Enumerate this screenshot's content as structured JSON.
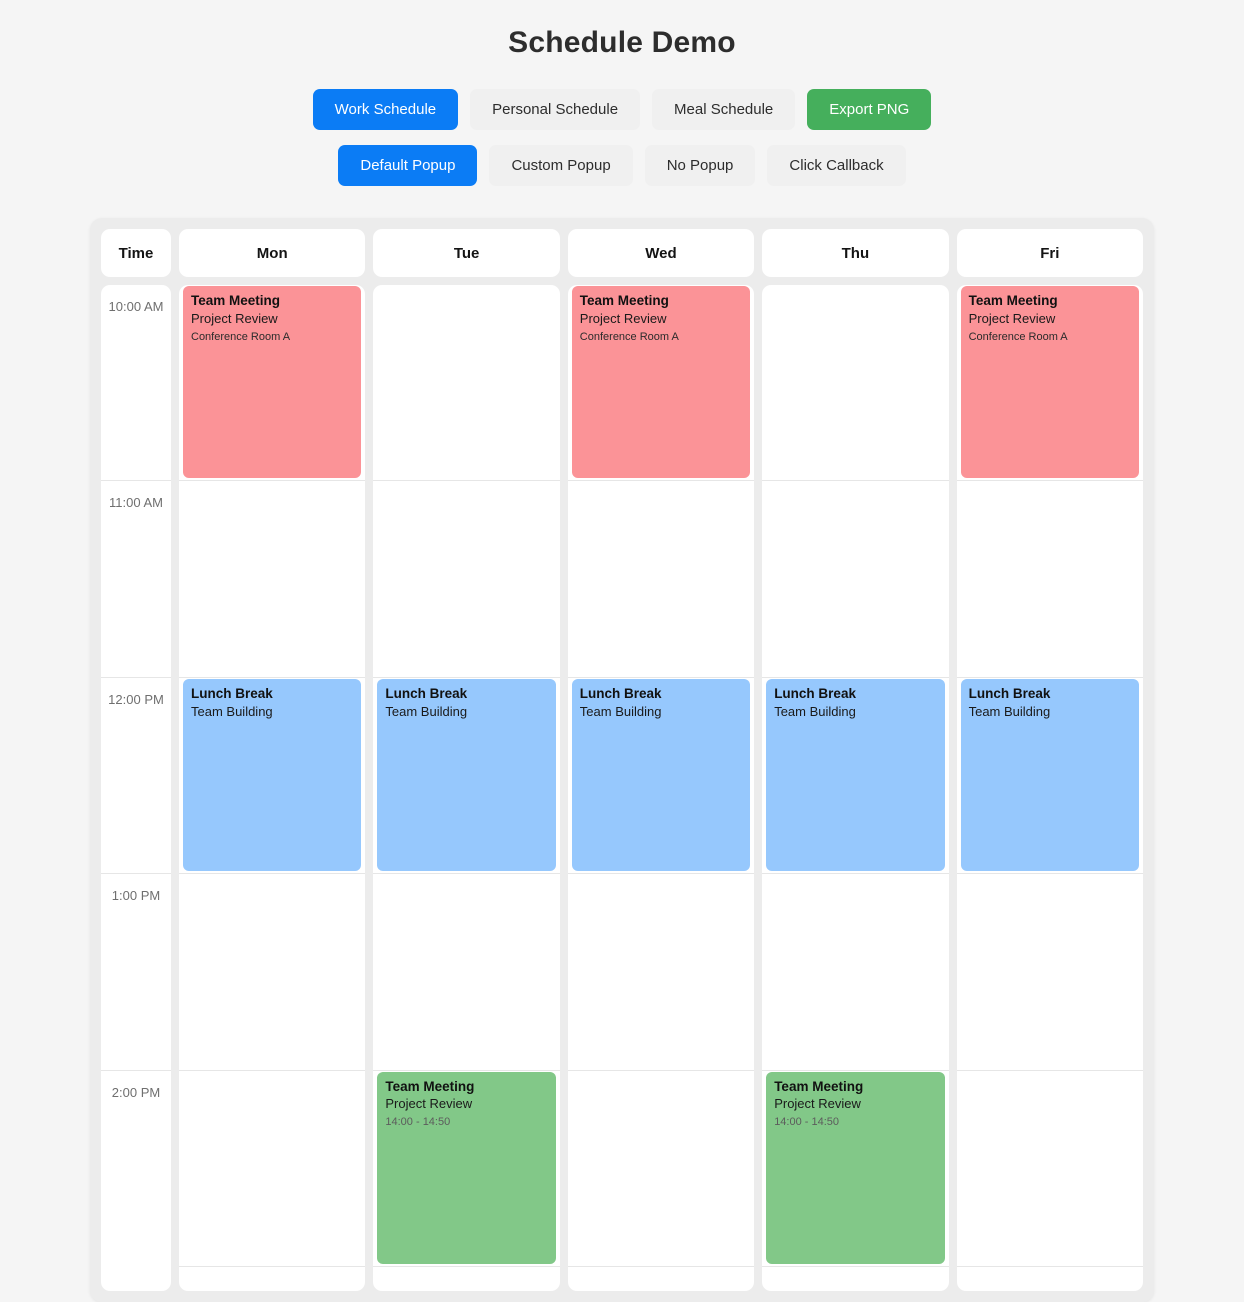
{
  "header": {
    "title": "Schedule Demo"
  },
  "toolbar": {
    "schedule_buttons": [
      {
        "label": "Work Schedule",
        "style": "primary",
        "active": true
      },
      {
        "label": "Personal Schedule",
        "style": "default",
        "active": false
      },
      {
        "label": "Meal Schedule",
        "style": "default",
        "active": false
      },
      {
        "label": "Export PNG",
        "style": "success",
        "active": false
      }
    ],
    "popup_buttons": [
      {
        "label": "Default Popup",
        "style": "primary",
        "active": true
      },
      {
        "label": "Custom Popup",
        "style": "default",
        "active": false
      },
      {
        "label": "No Popup",
        "style": "default",
        "active": false
      },
      {
        "label": "Click Callback",
        "style": "default",
        "active": false
      }
    ]
  },
  "calendar": {
    "columns": [
      "Time",
      "Mon",
      "Tue",
      "Wed",
      "Thu",
      "Fri"
    ],
    "time_slots": [
      "10:00 AM",
      "11:00 AM",
      "12:00 PM",
      "1:00 PM",
      "2:00 PM"
    ],
    "colors": {
      "meeting_red": "#fb9397",
      "lunch_blue": "#96c8fd",
      "meeting_green": "#82c888",
      "accent_blue": "#0b7cf5",
      "accent_green": "#45af5c",
      "panel_bg": "#ececec",
      "cell_bg": "#ffffff"
    },
    "events": [
      {
        "day": "Mon",
        "slot_index": 0,
        "span": 1,
        "title": "Team Meeting",
        "subtitle": "Project Review",
        "meta": "Conference Room A",
        "meta_muted": false,
        "color": "#fb9397"
      },
      {
        "day": "Wed",
        "slot_index": 0,
        "span": 1,
        "title": "Team Meeting",
        "subtitle": "Project Review",
        "meta": "Conference Room A",
        "meta_muted": false,
        "color": "#fb9397"
      },
      {
        "day": "Fri",
        "slot_index": 0,
        "span": 1,
        "title": "Team Meeting",
        "subtitle": "Project Review",
        "meta": "Conference Room A",
        "meta_muted": false,
        "color": "#fb9397"
      },
      {
        "day": "Mon",
        "slot_index": 2,
        "span": 1,
        "title": "Lunch Break",
        "subtitle": "Team Building",
        "meta": "",
        "meta_muted": false,
        "color": "#96c8fd"
      },
      {
        "day": "Tue",
        "slot_index": 2,
        "span": 1,
        "title": "Lunch Break",
        "subtitle": "Team Building",
        "meta": "",
        "meta_muted": false,
        "color": "#96c8fd"
      },
      {
        "day": "Wed",
        "slot_index": 2,
        "span": 1,
        "title": "Lunch Break",
        "subtitle": "Team Building",
        "meta": "",
        "meta_muted": false,
        "color": "#96c8fd"
      },
      {
        "day": "Thu",
        "slot_index": 2,
        "span": 1,
        "title": "Lunch Break",
        "subtitle": "Team Building",
        "meta": "",
        "meta_muted": false,
        "color": "#96c8fd"
      },
      {
        "day": "Fri",
        "slot_index": 2,
        "span": 1,
        "title": "Lunch Break",
        "subtitle": "Team Building",
        "meta": "",
        "meta_muted": false,
        "color": "#96c8fd"
      },
      {
        "day": "Tue",
        "slot_index": 4,
        "span": 1,
        "title": "Team Meeting",
        "subtitle": "Project Review",
        "meta": "14:00 - 14:50",
        "meta_muted": true,
        "color": "#82c888"
      },
      {
        "day": "Thu",
        "slot_index": 4,
        "span": 1,
        "title": "Team Meeting",
        "subtitle": "Project Review",
        "meta": "14:00 - 14:50",
        "meta_muted": true,
        "color": "#82c888"
      }
    ]
  }
}
